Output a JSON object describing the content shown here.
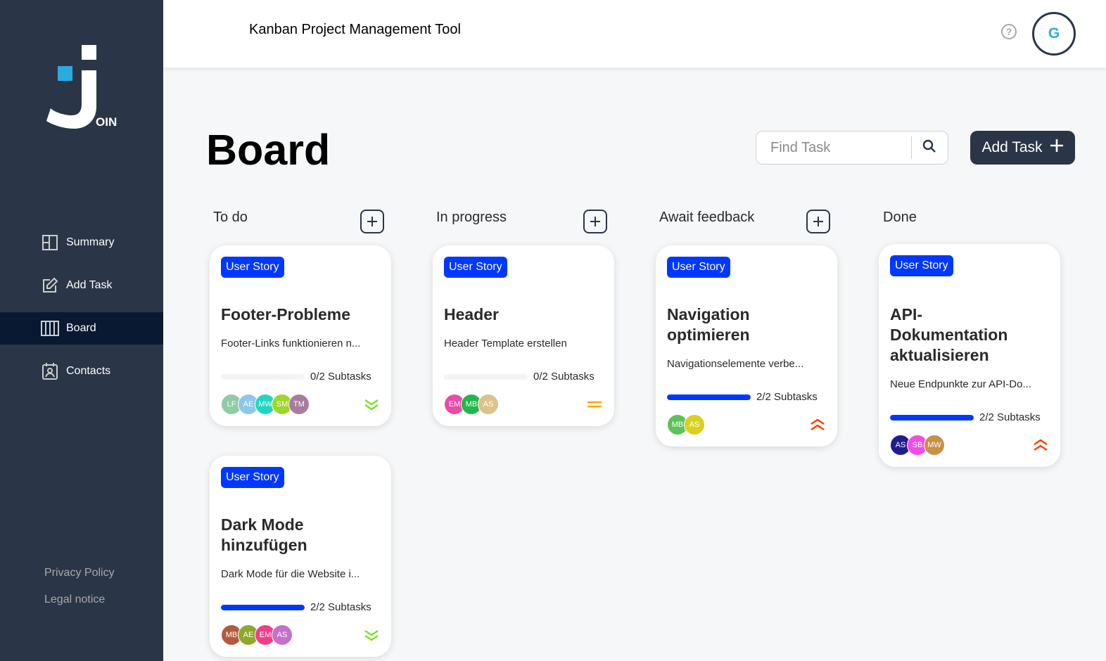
{
  "app": {
    "title": "Kanban Project Management Tool",
    "help_label": "?",
    "user_initial": "G",
    "logo_text": "OIN"
  },
  "sidebar": {
    "items": [
      {
        "label": "Summary",
        "icon": "summary-icon"
      },
      {
        "label": "Add Task",
        "icon": "edit-icon"
      },
      {
        "label": "Board",
        "icon": "board-icon",
        "active": true
      },
      {
        "label": "Contacts",
        "icon": "contacts-icon"
      }
    ],
    "privacy": "Privacy Policy",
    "legal": "Legal notice"
  },
  "board": {
    "title": "Board",
    "search_placeholder": "Find Task",
    "add_task_label": "Add Task"
  },
  "columns": [
    {
      "title": "To do"
    },
    {
      "title": "In progress"
    },
    {
      "title": "Await feedback"
    },
    {
      "title": "Done"
    }
  ],
  "cards": [
    {
      "category": "User Story",
      "title": "Footer-Probleme",
      "desc": "Footer-Links funktionieren n...",
      "subtasks": "0/2 Subtasks",
      "progress": 0,
      "priority": "low",
      "assignees": [
        {
          "i": "LF",
          "c": "#8fcba6"
        },
        {
          "i": "AE",
          "c": "#8ec8e8"
        },
        {
          "i": "MW",
          "c": "#1fd7c1"
        },
        {
          "i": "SM",
          "c": "#9ed62a"
        },
        {
          "i": "TM",
          "c": "#a87c9e"
        }
      ]
    },
    {
      "category": "User Story",
      "title": "Dark Mode hinzufügen",
      "desc": "Dark Mode für die Website i...",
      "subtasks": "2/2 Subtasks",
      "progress": 1,
      "priority": "low",
      "assignees": [
        {
          "i": "MB",
          "c": "#b45a3c"
        },
        {
          "i": "AE",
          "c": "#8ea82e"
        },
        {
          "i": "EM",
          "c": "#ef3f8c"
        },
        {
          "i": "AS",
          "c": "#c66fc8"
        }
      ]
    },
    {
      "category": "User Story",
      "title": "Header",
      "desc": "Header Template erstellen",
      "subtasks": "0/2 Subtasks",
      "progress": 0,
      "priority": "medium",
      "assignees": [
        {
          "i": "EM",
          "c": "#ea4aa8"
        },
        {
          "i": "MB",
          "c": "#1fb84a"
        },
        {
          "i": "AS",
          "c": "#dcc38a"
        }
      ]
    },
    {
      "category": "User Story",
      "title": "Navigation optimieren",
      "desc": "Navigationselemente verbe...",
      "subtasks": "2/2 Subtasks",
      "progress": 1,
      "priority": "urgent",
      "assignees": [
        {
          "i": "MB",
          "c": "#5ec25a"
        },
        {
          "i": "AS",
          "c": "#dcd01e"
        }
      ]
    },
    {
      "category": "User Story",
      "title": "API-Dokumentation aktualisieren",
      "desc": "Neue Endpunkte zur API-Do...",
      "subtasks": "2/2 Subtasks",
      "progress": 1,
      "priority": "urgent",
      "assignees": [
        {
          "i": "AS",
          "c": "#1f1c8c"
        },
        {
          "i": "SB",
          "c": "#f24ce8"
        },
        {
          "i": "MW",
          "c": "#c89046"
        }
      ]
    }
  ],
  "colors": {
    "sidebar": "#2a3647",
    "accent": "#29abe2",
    "badge": "#0038ff",
    "low": "#7ae229",
    "medium": "#ffa800",
    "urgent": "#ff3d00"
  }
}
